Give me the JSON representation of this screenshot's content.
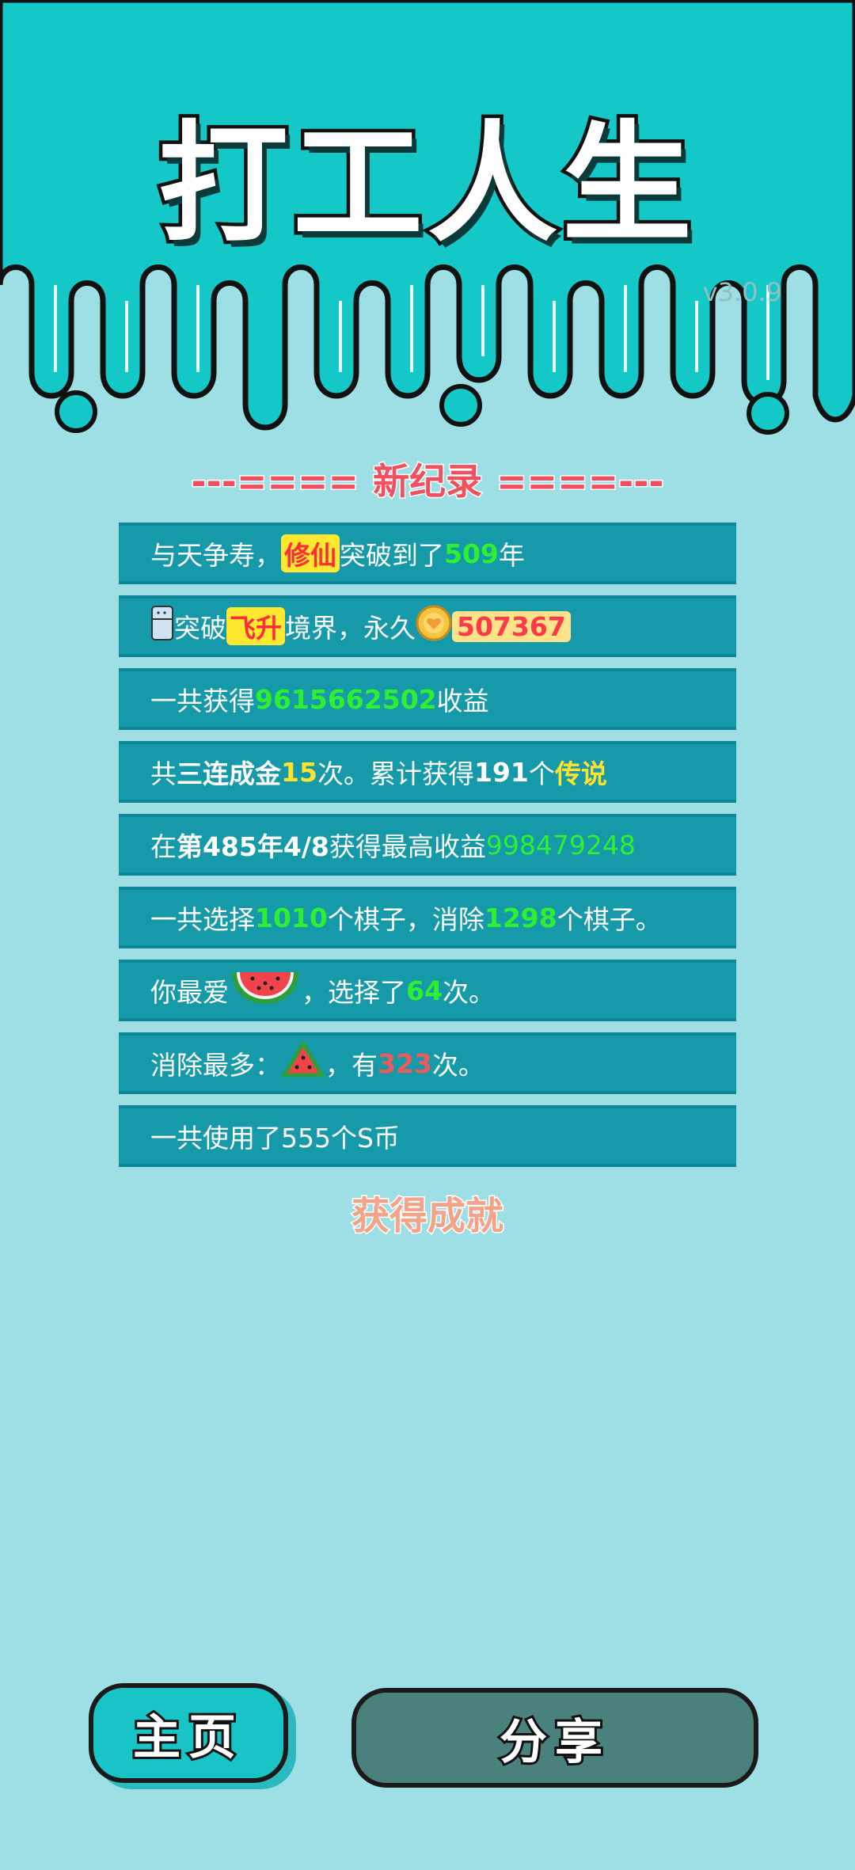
{
  "game": {
    "title": "打工人生",
    "version": "v3.0.9"
  },
  "colors": {
    "header_teal": "#14c8c8",
    "background": "#9edee5",
    "row_bg": "#169aaa",
    "highlight_green": "#2ef030",
    "highlight_yellow": "#ffe22e",
    "highlight_red": "#f05a5a",
    "home_button": "#19c4c6",
    "share_button": "#4b817d"
  },
  "record": {
    "dashes_left": "---====",
    "title": "新纪录",
    "dashes_right": "====---"
  },
  "stats": [
    {
      "parts": [
        "与天争寿，",
        "修仙",
        "突破到了",
        "509",
        "年"
      ]
    },
    {
      "icon": "fridge-icon",
      "parts": [
        "突破",
        "飞升",
        "境界，永久",
        "507367"
      ],
      "coin_icon": "coin-icon"
    },
    {
      "parts": [
        "一共获得",
        "9615662502",
        "收益"
      ]
    },
    {
      "parts": [
        "共",
        "三连成金",
        "15",
        "次。累计获得",
        "191",
        "个",
        "传说"
      ]
    },
    {
      "parts": [
        "在 ",
        "第485年4/8",
        " 获得最高收益",
        "998479248"
      ]
    },
    {
      "parts": [
        "一共选择",
        "1010",
        "个棋子，消除",
        "1298",
        "个棋子。"
      ]
    },
    {
      "parts": [
        "你最爱",
        "，选择了",
        "64",
        "次。"
      ],
      "icon": "watermelon-icon"
    },
    {
      "parts": [
        "消除最多：",
        "，有",
        "323",
        "次。"
      ],
      "icon": "watermelon-slice-icon"
    },
    {
      "parts": [
        "一共使用了555个S币"
      ]
    }
  ],
  "achievement_label": "获得成就",
  "buttons": {
    "home": "主页",
    "share": "分享"
  }
}
